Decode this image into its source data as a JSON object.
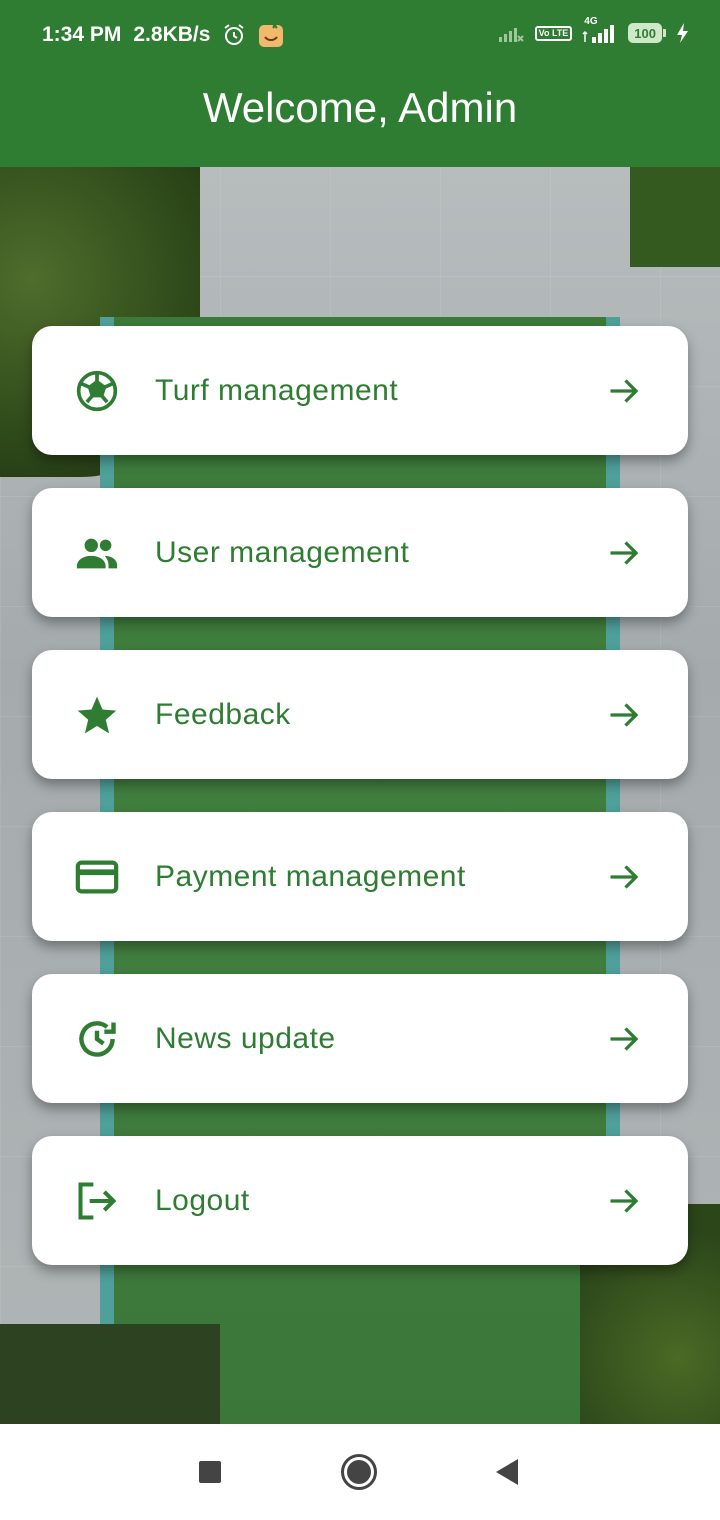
{
  "status_bar": {
    "time": "1:34 PM",
    "network_speed": "2.8KB/s",
    "network_type": "4G",
    "volte_label": "Vo LTE",
    "battery": "100"
  },
  "app_bar": {
    "title": "Welcome, Admin"
  },
  "menu": {
    "items": [
      {
        "label": "Turf management",
        "icon": "soccer-ball-icon"
      },
      {
        "label": "User management",
        "icon": "people-icon"
      },
      {
        "label": "Feedback",
        "icon": "star-icon"
      },
      {
        "label": "Payment management",
        "icon": "credit-card-icon"
      },
      {
        "label": "News update",
        "icon": "update-clock-icon"
      },
      {
        "label": "Logout",
        "icon": "logout-icon"
      }
    ],
    "arrow_icon": "arrow-right-icon"
  },
  "colors": {
    "primary": "#2e7d32",
    "card_background": "#ffffff",
    "nav_icon": "#444444"
  }
}
